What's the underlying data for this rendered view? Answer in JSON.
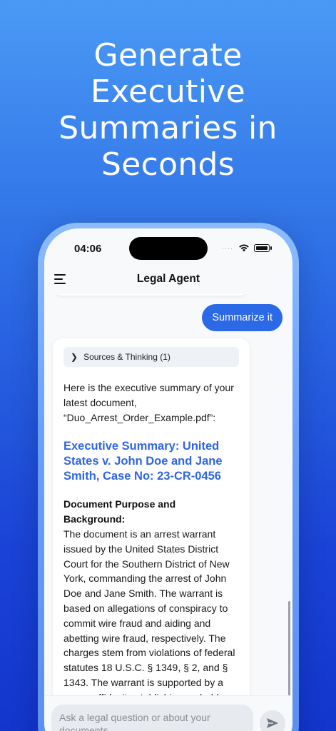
{
  "hero": {
    "lines": [
      "Generate",
      "Executive",
      "Summaries in",
      "Seconds"
    ]
  },
  "status_bar": {
    "time": "04:06",
    "signal_dots": "....",
    "icons": [
      "wifi-icon",
      "battery-icon"
    ]
  },
  "nav": {
    "title": "Legal Agent",
    "menu_icon": "hamburger-menu-icon"
  },
  "chat": {
    "user_message": "Summarize it",
    "agent": {
      "sources_label": "Sources & Thinking (1)",
      "intro": "Here is the executive summary of your latest document, “Duo_Arrest_Order_Example.pdf”:",
      "summary_title": "Executive Summary: United States v. John Doe and Jane Smith, Case No: 23-CR-0456",
      "section_heading": "Document Purpose and Background:",
      "section_body": "The document is an arrest warrant issued by the United States District Court for the Southern District of New York, commanding the arrest of John Doe and Jane Smith. The warrant is based on allegations of conspiracy to commit wire fraud and aiding and abetting wire fraud, respectively. The charges stem from violations of federal statutes 18 U.S.C. § 1349, § 2, and § 1343. The warrant is supported by a sworn affidavit establishing probable"
    }
  },
  "composer": {
    "placeholder": "Ask a legal question or about your documents",
    "send_icon": "send-icon"
  },
  "colors": {
    "accent": "#2c69e6",
    "summary_title": "#2e66e4",
    "background_top": "#4a9af5",
    "background_bottom": "#1335cc"
  }
}
